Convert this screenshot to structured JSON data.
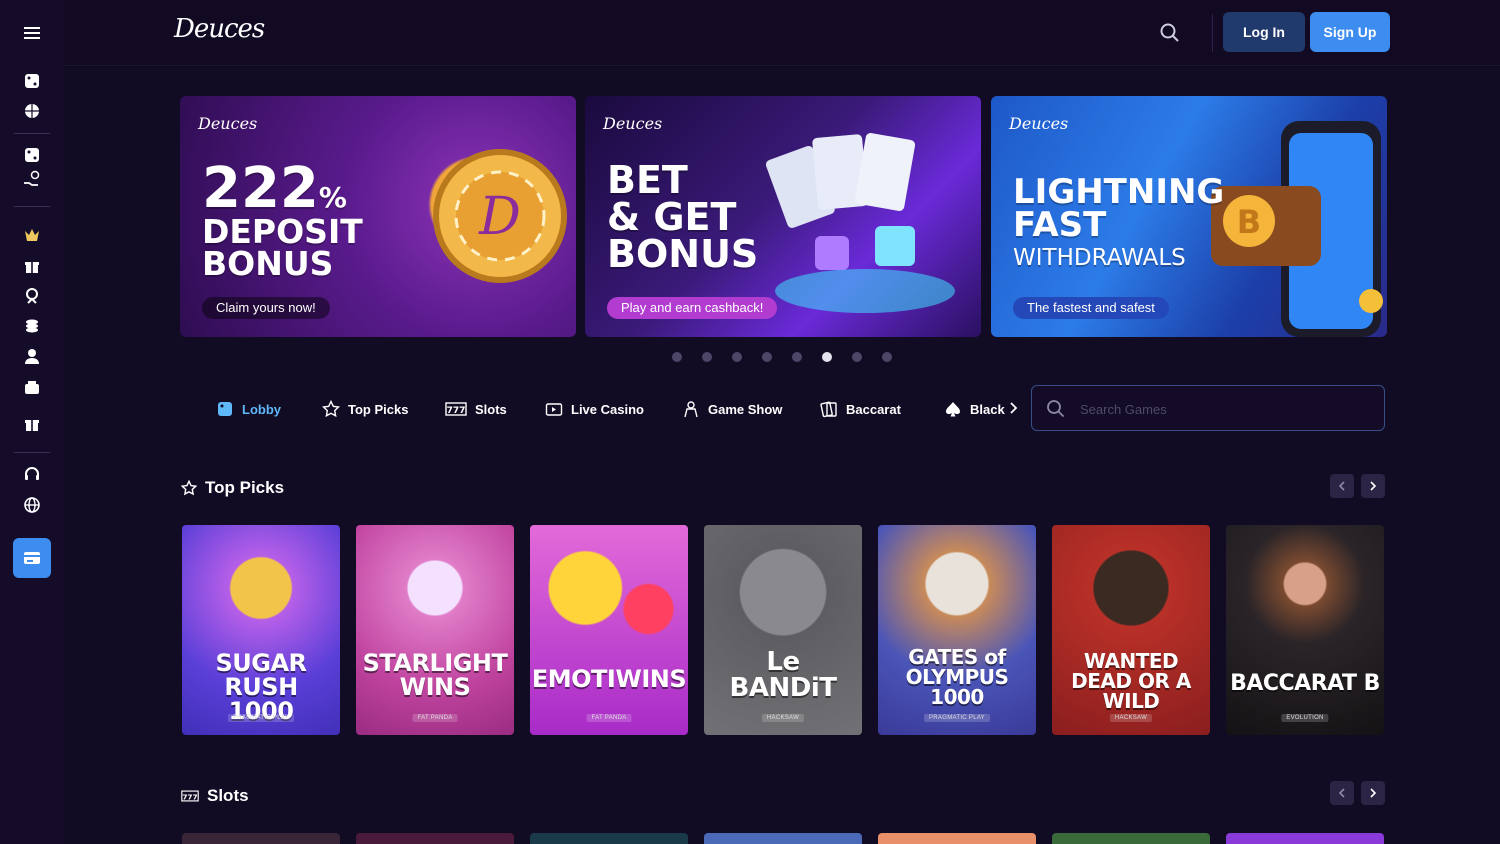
{
  "header": {
    "logo": "Deuces",
    "login_label": "Log In",
    "signup_label": "Sign Up"
  },
  "banners": [
    {
      "logo": "Deuces",
      "title_number": "222",
      "title_suffix": "%",
      "title_rest": "DEPOSIT\nBONUS",
      "pill": "Claim yours now!"
    },
    {
      "logo": "Deuces",
      "title": "BET\n& GET\nBONUS",
      "pill": "Play and earn cashback!"
    },
    {
      "logo": "Deuces",
      "title": "LIGHTNING\nFAST",
      "subtitle": "WITHDRAWALS",
      "pill": "The fastest and safest"
    }
  ],
  "carousel": {
    "total": 8,
    "active_index": 5
  },
  "tabs": [
    {
      "label": "Lobby",
      "icon": "lobby-icon",
      "active": true
    },
    {
      "label": "Top Picks",
      "icon": "star-icon"
    },
    {
      "label": "Slots",
      "icon": "slots-777-icon"
    },
    {
      "label": "Live Casino",
      "icon": "tv-icon"
    },
    {
      "label": "Game Show",
      "icon": "host-icon"
    },
    {
      "label": "Baccarat",
      "icon": "cards-icon"
    },
    {
      "label": "Black",
      "icon": "spade-icon"
    }
  ],
  "search": {
    "placeholder": "Search Games"
  },
  "sections": {
    "top_picks": {
      "title": "Top Picks"
    },
    "slots": {
      "title": "Slots"
    }
  },
  "games": [
    {
      "name": "SUGAR RUSH\n1000",
      "provider": "PRAGMATIC PLAY",
      "bg": "#5b3fd8"
    },
    {
      "name": "STARLIGHT\nWINS",
      "provider": "FAT PANDA",
      "bg": "#c0449f"
    },
    {
      "name": "EMOTIWINS",
      "provider": "FAT PANDA",
      "bg": "#b33ad1"
    },
    {
      "name": "Le\nBANDiT",
      "provider": "HACKSAW",
      "bg": "#6b6b70"
    },
    {
      "name": "GATES of\nOLYMPUS\n1000",
      "provider": "PRAGMATIC PLAY",
      "bg": "#4a55b8"
    },
    {
      "name": "WANTED\nDEAD OR A WILD",
      "provider": "HACKSAW",
      "bg": "#9c2424"
    },
    {
      "name": "BACCARAT B",
      "provider": "EVOLUTION",
      "bg": "#1e1c1e"
    }
  ],
  "colors": {
    "accent": "#3d8cf0",
    "background": "#120b24",
    "login": "#213a6e"
  }
}
